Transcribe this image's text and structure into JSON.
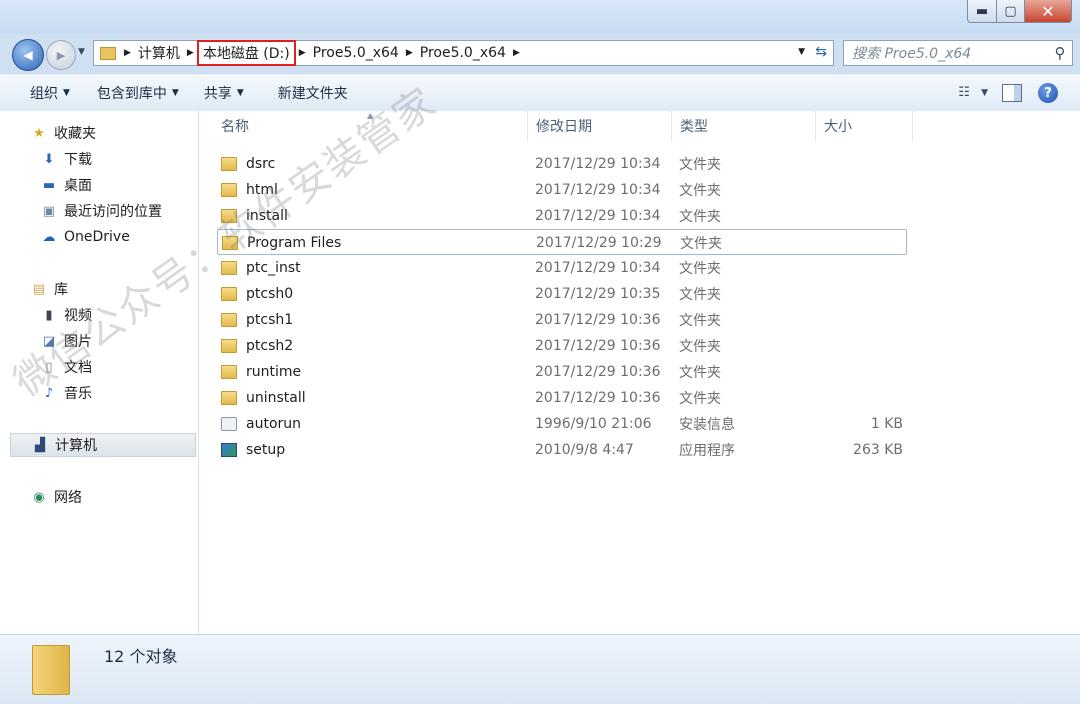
{
  "window": {
    "controls": {
      "minimize": "▬",
      "maximize": "▢",
      "close": "✕"
    }
  },
  "nav": {
    "back_icon": "◀",
    "forward_icon": "▶",
    "breadcrumb": [
      "计算机",
      "本地磁盘 (D:)",
      "Proe5.0_x64",
      "Proe5.0_x64"
    ],
    "highlighted_crumb": "本地磁盘 (D:)",
    "search_placeholder": "搜索 Proe5.0_x64"
  },
  "toolbar": {
    "organize": "组织",
    "include_library": "包含到库中",
    "share": "共享",
    "new_folder": "新建文件夹"
  },
  "sidebar": {
    "favorites": {
      "label": "收藏夹",
      "items": [
        "下载",
        "桌面",
        "最近访问的位置",
        "OneDrive"
      ]
    },
    "libraries": {
      "label": "库",
      "items": [
        "视频",
        "图片",
        "文档",
        "音乐"
      ]
    },
    "computer": "计算机",
    "network": "网络"
  },
  "columns": {
    "name": "名称",
    "modified": "修改日期",
    "type": "类型",
    "size": "大小"
  },
  "files": [
    {
      "name": "dsrc",
      "modified": "2017/12/29 10:34",
      "type": "文件夹",
      "size": "",
      "icon": "folder-icon"
    },
    {
      "name": "html",
      "modified": "2017/12/29 10:34",
      "type": "文件夹",
      "size": "",
      "icon": "folder-icon"
    },
    {
      "name": "install",
      "modified": "2017/12/29 10:34",
      "type": "文件夹",
      "size": "",
      "icon": "folder-icon"
    },
    {
      "name": "Program Files",
      "modified": "2017/12/29 10:29",
      "type": "文件夹",
      "size": "",
      "icon": "folder-icon",
      "selected": true
    },
    {
      "name": "ptc_inst",
      "modified": "2017/12/29 10:34",
      "type": "文件夹",
      "size": "",
      "icon": "folder-icon"
    },
    {
      "name": "ptcsh0",
      "modified": "2017/12/29 10:35",
      "type": "文件夹",
      "size": "",
      "icon": "folder-icon"
    },
    {
      "name": "ptcsh1",
      "modified": "2017/12/29 10:36",
      "type": "文件夹",
      "size": "",
      "icon": "folder-icon"
    },
    {
      "name": "ptcsh2",
      "modified": "2017/12/29 10:36",
      "type": "文件夹",
      "size": "",
      "icon": "folder-icon"
    },
    {
      "name": "runtime",
      "modified": "2017/12/29 10:36",
      "type": "文件夹",
      "size": "",
      "icon": "folder-icon"
    },
    {
      "name": "uninstall",
      "modified": "2017/12/29 10:36",
      "type": "文件夹",
      "size": "",
      "icon": "folder-icon"
    },
    {
      "name": "autorun",
      "modified": "1996/9/10 21:06",
      "type": "安装信息",
      "size": "1 KB",
      "icon": "setup-info-icon"
    },
    {
      "name": "setup",
      "modified": "2010/9/8 4:47",
      "type": "应用程序",
      "size": "263 KB",
      "icon": "application-icon"
    }
  ],
  "status": {
    "count": "12 个对象"
  },
  "watermark": "微信公众号：软件安装管家"
}
